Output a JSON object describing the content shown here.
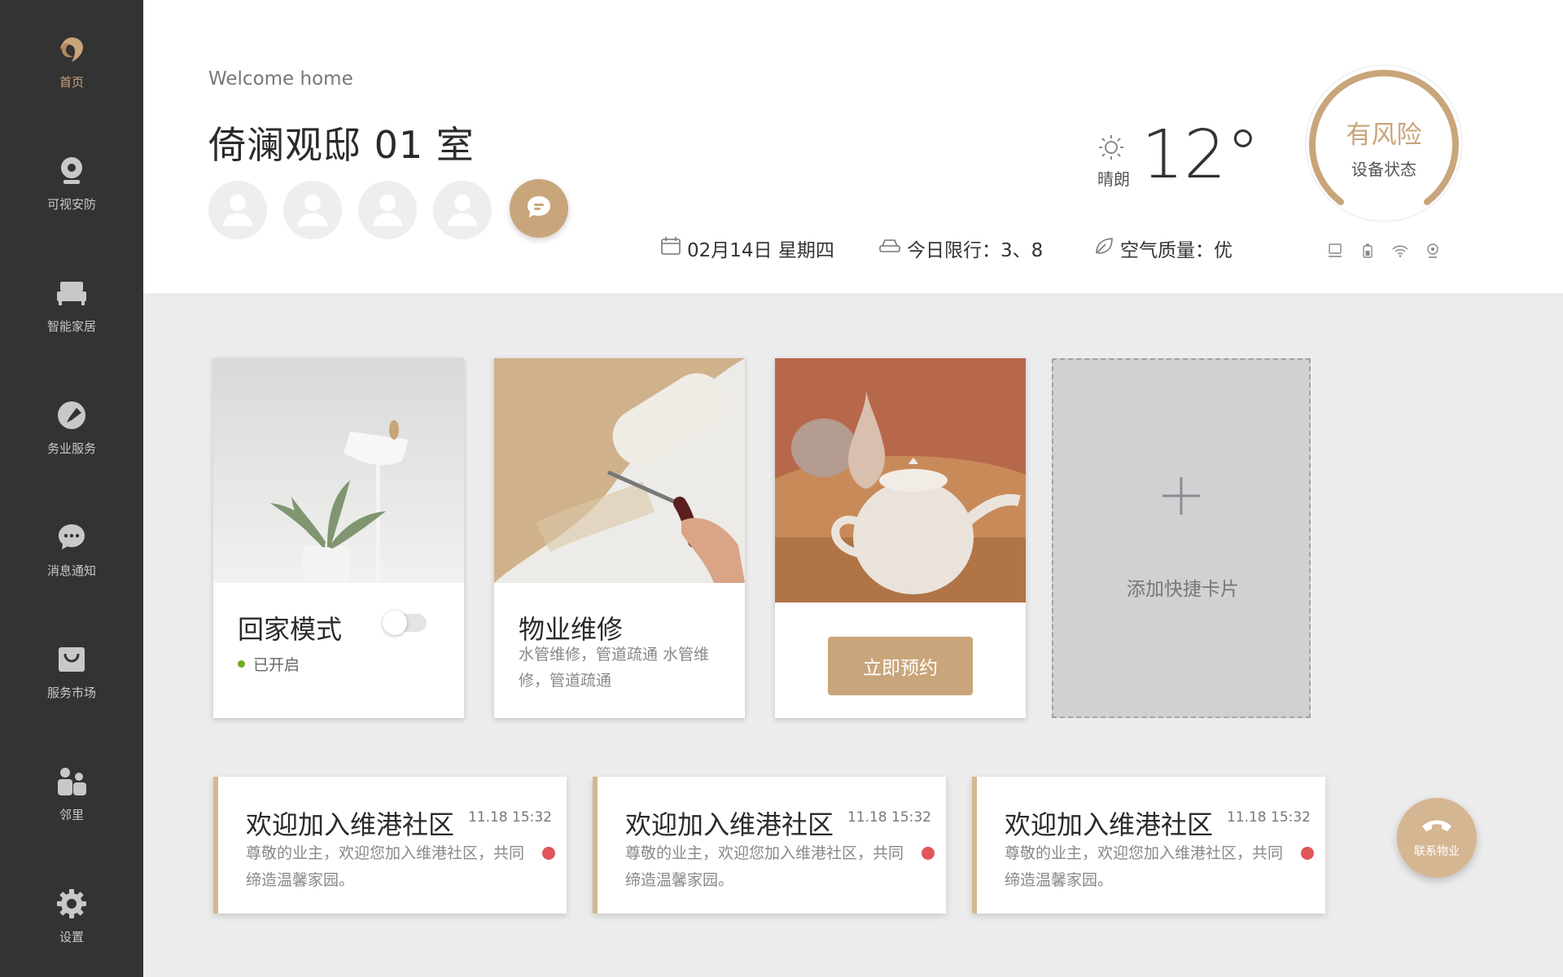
{
  "sidebar": {
    "items": [
      {
        "label": "首页",
        "icon": "logo-icon",
        "active": true
      },
      {
        "label": "可视安防",
        "icon": "camera-icon"
      },
      {
        "label": "智能家居",
        "icon": "bed-icon"
      },
      {
        "label": "务业服务",
        "icon": "wrench-icon"
      },
      {
        "label": "消息通知",
        "icon": "chat-bubble-icon"
      },
      {
        "label": "服务市场",
        "icon": "shopping-bag-icon"
      },
      {
        "label": "邻里",
        "icon": "people-icon"
      },
      {
        "label": "设置",
        "icon": "gear-icon"
      }
    ]
  },
  "header": {
    "welcome": "Welcome home",
    "room": "倚澜观邸 01 室",
    "weather_text": "晴朗",
    "temperature": "12°",
    "date": "02月14日 星期四",
    "traffic_limit": "今日限行：3、8",
    "air_quality": "空气质量：优"
  },
  "device_status": {
    "risk_label": "有风险",
    "status_label": "设备状态"
  },
  "cards": {
    "home_mode": {
      "title": "回家模式",
      "status": "已开启",
      "toggle_on": false
    },
    "repair": {
      "title": "物业维修",
      "desc": "水管维修，管道疏通 水管维修，管道疏通"
    },
    "booking": {
      "button": "立即预约"
    },
    "add": {
      "label": "添加快捷卡片"
    }
  },
  "notices": [
    {
      "title": "欢迎加入维港社区",
      "time": "11.18 15:32",
      "body": "尊敬的业主，欢迎您加入维港社区，共同缔造温馨家园。"
    },
    {
      "title": "欢迎加入维港社区",
      "time": "11.18 15:32",
      "body": "尊敬的业主，欢迎您加入维港社区，共同缔造温馨家园。"
    },
    {
      "title": "欢迎加入维港社区",
      "time": "11.18 15:32",
      "body": "尊敬的业主，欢迎您加入维港社区，共同缔造温馨家园。"
    }
  ],
  "contact": {
    "label": "联系物业"
  },
  "colors": {
    "accent": "#c9a57b",
    "sidebar": "#333333",
    "alert": "#e0575b",
    "ok": "#6bb01c"
  }
}
